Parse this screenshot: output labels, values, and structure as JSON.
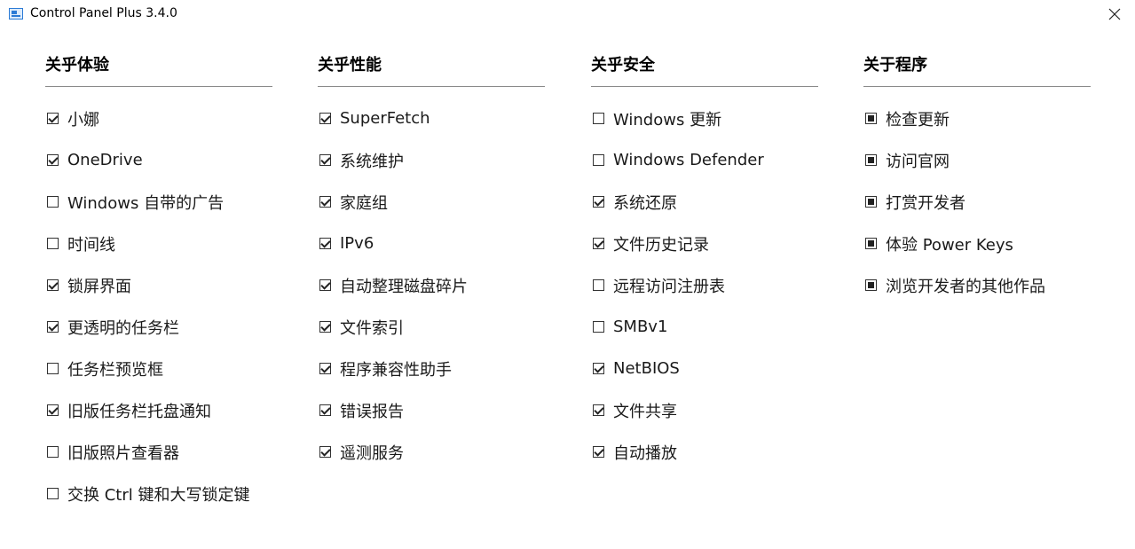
{
  "window": {
    "title": "Control Panel Plus 3.4.0"
  },
  "columns": [
    {
      "header": "关乎体验",
      "items": [
        {
          "label": "小娜",
          "state": "checked"
        },
        {
          "label": "OneDrive",
          "state": "checked"
        },
        {
          "label": "Windows 自带的广告",
          "state": "unchecked"
        },
        {
          "label": "时间线",
          "state": "unchecked"
        },
        {
          "label": "锁屏界面",
          "state": "checked"
        },
        {
          "label": "更透明的任务栏",
          "state": "checked"
        },
        {
          "label": "任务栏预览框",
          "state": "unchecked"
        },
        {
          "label": "旧版任务栏托盘通知",
          "state": "checked"
        },
        {
          "label": "旧版照片查看器",
          "state": "unchecked"
        },
        {
          "label": "交换 Ctrl 键和大写锁定键",
          "state": "unchecked"
        }
      ]
    },
    {
      "header": "关乎性能",
      "items": [
        {
          "label": "SuperFetch",
          "state": "checked"
        },
        {
          "label": "系统维护",
          "state": "checked"
        },
        {
          "label": "家庭组",
          "state": "checked"
        },
        {
          "label": "IPv6",
          "state": "checked"
        },
        {
          "label": "自动整理磁盘碎片",
          "state": "checked"
        },
        {
          "label": "文件索引",
          "state": "checked"
        },
        {
          "label": "程序兼容性助手",
          "state": "checked"
        },
        {
          "label": "错误报告",
          "state": "checked"
        },
        {
          "label": "遥测服务",
          "state": "checked"
        }
      ]
    },
    {
      "header": "关乎安全",
      "items": [
        {
          "label": "Windows 更新",
          "state": "unchecked"
        },
        {
          "label": "Windows Defender",
          "state": "unchecked"
        },
        {
          "label": "系统还原",
          "state": "checked"
        },
        {
          "label": "文件历史记录",
          "state": "checked"
        },
        {
          "label": "远程访问注册表",
          "state": "unchecked"
        },
        {
          "label": "SMBv1",
          "state": "unchecked"
        },
        {
          "label": "NetBIOS",
          "state": "checked"
        },
        {
          "label": "文件共享",
          "state": "checked"
        },
        {
          "label": "自动播放",
          "state": "checked"
        }
      ]
    },
    {
      "header": "关于程序",
      "items": [
        {
          "label": "检查更新",
          "state": "filled"
        },
        {
          "label": "访问官网",
          "state": "filled"
        },
        {
          "label": "打赏开发者",
          "state": "filled"
        },
        {
          "label": "体验 Power Keys",
          "state": "filled"
        },
        {
          "label": "浏览开发者的其他作品",
          "state": "filled"
        }
      ]
    }
  ],
  "icons": {
    "app": "app-window-icon",
    "close": "close-icon"
  }
}
